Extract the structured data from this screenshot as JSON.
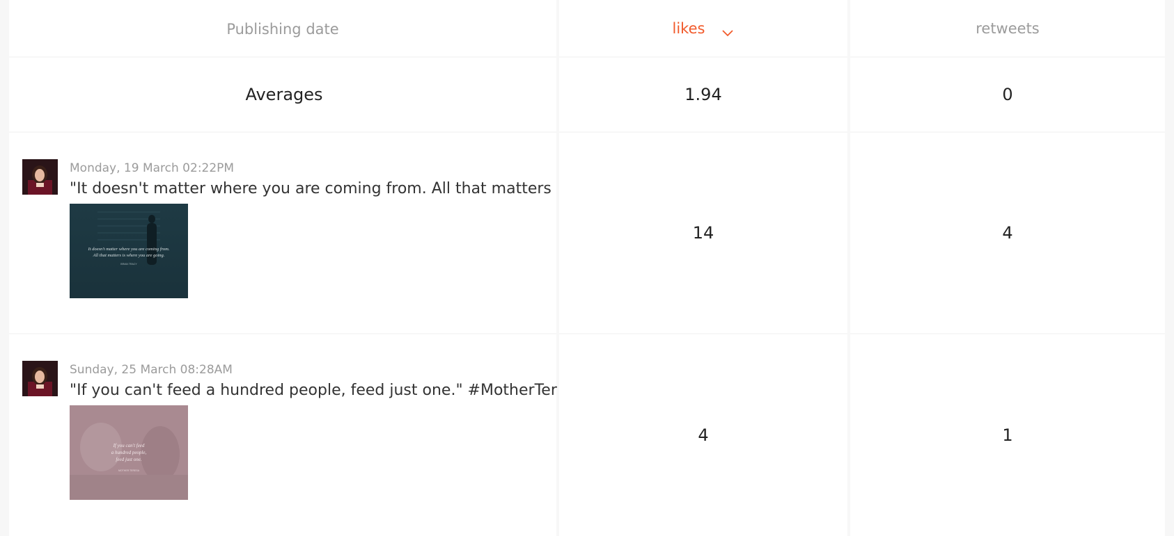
{
  "table": {
    "headers": {
      "publishing_date": "Publishing date",
      "likes": "likes",
      "retweets": "retweets"
    },
    "sort_icon": "chevron-down-icon",
    "averages": {
      "label": "Averages",
      "likes": "1.94",
      "retweets": "0"
    },
    "posts": [
      {
        "date": "Monday, 19 March 02:22PM",
        "text": "\"It doesn't matter where you are coming from. All that matters is ...",
        "likes": "14",
        "retweets": "4",
        "thumb_lines": [
          "It doesn't matter where you are coming from.",
          "All that matters is where you are going."
        ],
        "thumb_caption": "BRIAN TRACY"
      },
      {
        "date": "Sunday, 25 March 08:28AM",
        "text": "\"If you can't feed a hundred people, feed just one.\" #MotherTeres...",
        "likes": "4",
        "retweets": "1",
        "thumb_lines": [
          "If you can't feed",
          "a hundred people,",
          "feed just one."
        ],
        "thumb_caption": "MOTHER TERESA"
      }
    ]
  },
  "colors": {
    "accent": "#f15a2b",
    "muted": "#9b9b9b",
    "background": "#f7f7f7"
  }
}
